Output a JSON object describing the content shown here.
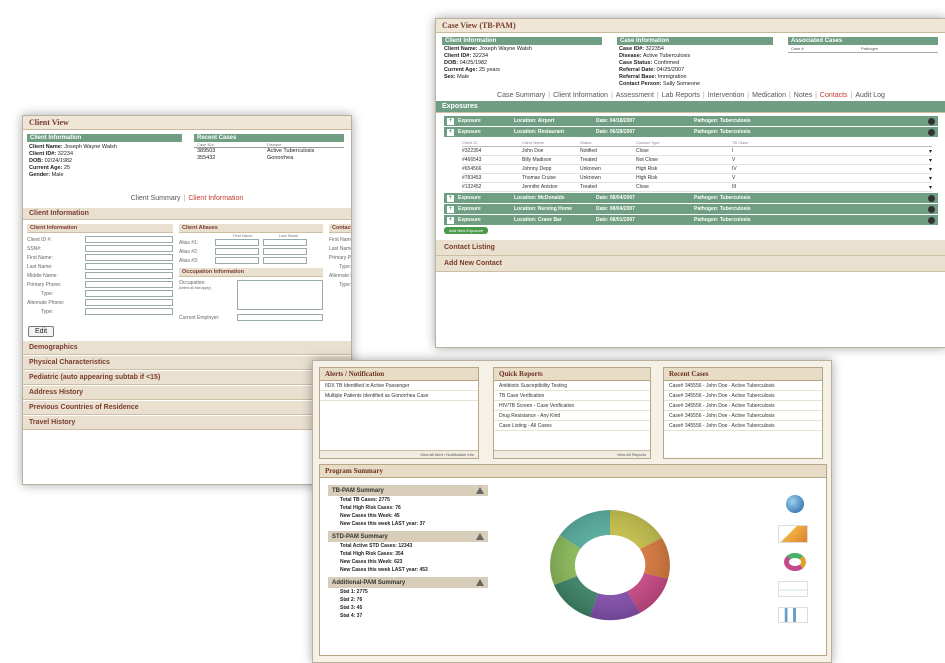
{
  "client_view": {
    "title": "Client View",
    "client_info_header": "Client Information",
    "client_info": [
      {
        "label": "Client Name:",
        "value": "Joseph Wayne Walsh"
      },
      {
        "label": "Client ID#:",
        "value": "32234"
      },
      {
        "label": "DOB:",
        "value": "02/24/1982"
      },
      {
        "label": "Current Age:",
        "value": "25"
      },
      {
        "label": "Gender:",
        "value": "Male"
      }
    ],
    "recent_cases_header": "Recent Cases",
    "recent_cases_cols": [
      "Case ID#",
      "Disease"
    ],
    "recent_cases": [
      {
        "id": "389503",
        "disease": "Active Tuberculosis"
      },
      {
        "id": "355432",
        "disease": "Gonorrhea"
      }
    ],
    "tabs": {
      "summary": "Client Summary",
      "sep": "|",
      "info": "Client Information"
    },
    "section_bar": "Client Information",
    "ci_form_header": "Client Information",
    "ci_fields": [
      "Client ID #:",
      "SSN#:",
      "First Name:",
      "Last Name:",
      "Middle Name:",
      "Primary Phone:",
      "Type:",
      "Alternate Phone:",
      "Type:"
    ],
    "aliases_header": "Client Aliases",
    "aliases_cols": [
      "First Name",
      "Last Name"
    ],
    "aliases": [
      "Alias #1:",
      "Alias #2:",
      "Alias #3:"
    ],
    "occupation_header": "Occupation Information",
    "occupation_label": "Occupation:",
    "occupation_hint": "(select all that apply)",
    "employer_label": "Current Employer:",
    "contact_header": "Contact Person",
    "contact_fields": [
      "First Name:",
      "Last Name:",
      "Primary Phone:",
      "Type:",
      "Alternate Phone:",
      "Type:"
    ],
    "edit_label": "Edit",
    "bars": [
      "Demographics",
      "Physical Characteristics",
      "Pediatric (auto appearing subtab if <15)",
      "Address History",
      "Previous Countries of Residence",
      "Travel History"
    ]
  },
  "case_view": {
    "title": "Case View (TB-PAM)",
    "client_info_header": "Client Information",
    "client_info": [
      {
        "label": "Client Name:",
        "value": "Joseph Wayne Walsh"
      },
      {
        "label": "Client ID#:",
        "value": "32234"
      },
      {
        "label": "DOB:",
        "value": "04/25/1982"
      },
      {
        "label": "Current Age:",
        "value": "25 years"
      },
      {
        "label": "Sex:",
        "value": "Male"
      }
    ],
    "case_info_header": "Case Information",
    "case_info": [
      {
        "label": "Case ID#:",
        "value": "322354"
      },
      {
        "label": "Disease:",
        "value": "Active Tuberculosis"
      },
      {
        "label": "Case Status:",
        "value": "Confirmed"
      },
      {
        "label": "Referral Date:",
        "value": "04/25/2007"
      },
      {
        "label": "Referral Base:",
        "value": "Immigration"
      },
      {
        "label": "Contact Person:",
        "value": "Sally Someone"
      }
    ],
    "assoc_header": "Associated Cases",
    "assoc_cols": [
      "Case #",
      "Pathogen"
    ],
    "tabs": [
      {
        "label": "Case Summary",
        "active": false
      },
      {
        "label": "Client Information",
        "active": false
      },
      {
        "label": "Assessment",
        "active": false
      },
      {
        "label": "Lab Reports",
        "active": false
      },
      {
        "label": "Intervention",
        "active": false
      },
      {
        "label": "Medication",
        "active": false
      },
      {
        "label": "Notes",
        "active": false
      },
      {
        "label": "Contacts",
        "active": true
      },
      {
        "label": "Audit Log",
        "active": false
      }
    ],
    "tab_sep": "|",
    "exposures_bar": "Exposures",
    "exposures_before": [
      {
        "name": "Exposure",
        "location": "Location: Airport",
        "date": "Date: 04/18/2007",
        "pathogen": "Pathogen: Tuberculosis"
      },
      {
        "name": "Exposure",
        "location": "Location: Restaurant",
        "date": "Date: 06/28/2007",
        "pathogen": "Pathogen: Tuberculosis"
      }
    ],
    "contact_cols": [
      "Client ID",
      "Client Name",
      "Status",
      "Contact Type",
      "TB Class"
    ],
    "contacts": [
      {
        "id": "#322354",
        "name": "John Doe",
        "status": "Notified",
        "type": "Close",
        "cls": "I"
      },
      {
        "id": "#466543",
        "name": "Billy Madison",
        "status": "Treated",
        "type": "Not Close",
        "cls": "V"
      },
      {
        "id": "#654566",
        "name": "Johnny Depp",
        "status": "Unknown",
        "type": "High Risk",
        "cls": "IV"
      },
      {
        "id": "#783453",
        "name": "Thomas Cruise",
        "status": "Unknown",
        "type": "High Risk",
        "cls": "V"
      },
      {
        "id": "#132452",
        "name": "Jennifer Aniston",
        "status": "Treated",
        "type": "Close",
        "cls": "III"
      }
    ],
    "exposures_after": [
      {
        "name": "Exposure",
        "location": "Location: McDonalds",
        "date": "Date: 08/04/2007",
        "pathogen": "Pathogen: Tuberculosis"
      },
      {
        "name": "Exposure",
        "location": "Location: Nursing Home",
        "date": "Date: 08/04/2007",
        "pathogen": "Pathogen: Tuberculosis"
      },
      {
        "name": "Exposure",
        "location": "Location: Crane Bar",
        "date": "Date: 08/01/2007",
        "pathogen": "Pathogen: Tuberculosis"
      }
    ],
    "add_exposure": "Add New Exposure",
    "contact_listing": "Contact Listing",
    "add_contact": "Add New Contact"
  },
  "dashboard": {
    "alerts_title": "Alerts / Notification",
    "alerts": [
      "IIDX TB Identified in Active Passenger",
      "Multiple Patients Identified as Gonorrhea Case"
    ],
    "alerts_footer": "View All Alert / Notification Info",
    "reports_title": "Quick Reports",
    "reports": [
      "Antibiotic Susceptibility Testing",
      "TB Case Verification",
      "HIV/TB Screen - Case Verification",
      "Drug Resistance - Any Kind",
      "Case Listing - All Cases"
    ],
    "reports_footer": "View All Reports",
    "recent_title": "Recent Cases",
    "recent": [
      "Case# 345556 - John Doe - Active Tuberculosis",
      "Case# 345556 - John Doe - Active Tuberculosis",
      "Case# 345556 - John Doe - Active Tuberculosis",
      "Case# 345556 - John Doe - Active Tuberculosis",
      "Case# 345556 - John Doe - Active Tuberculosis"
    ],
    "program_title": "Program Summary",
    "summaries": [
      {
        "title": "TB-PAM Summary",
        "lines": [
          "Total TB Cases: 2775",
          "Total High Risk Cases: 76",
          "New Cases this Week: 45",
          "New Cases this week LAST year: 37"
        ]
      },
      {
        "title": "STD-PAM Summary",
        "lines": [
          "Total Active STD Cases: 12343",
          "Total High Risk Cases: 354",
          "New Cases this Week: 623",
          "New Cases this week LAST year: 453"
        ]
      },
      {
        "title": "Additional-PAM Summary",
        "lines": [
          "Stat 1: 2775",
          "Stat 2: 76",
          "Stat 3: 45",
          "Stat 4: 37"
        ]
      }
    ]
  }
}
